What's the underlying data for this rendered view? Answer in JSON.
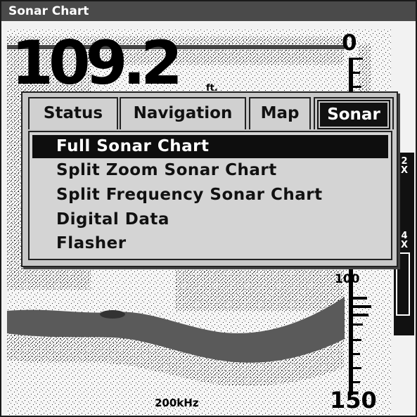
{
  "window": {
    "title": "Sonar Chart"
  },
  "readout": {
    "depth": "109.2",
    "unit": "ft."
  },
  "scale": {
    "top": "0",
    "mid": "100",
    "bottom": "150"
  },
  "frequency": "200kHz",
  "zoom": {
    "label_2x": "2\nX",
    "label_4x": "4\nX"
  },
  "menu": {
    "tabs": [
      {
        "label": "Status"
      },
      {
        "label": "Navigation"
      },
      {
        "label": "Map"
      },
      {
        "label": "Sonar",
        "selected": true
      }
    ],
    "items": [
      {
        "label": "Full Sonar Chart",
        "selected": true
      },
      {
        "label": "Split Zoom Sonar Chart"
      },
      {
        "label": "Split Frequency Sonar Chart"
      },
      {
        "label": "Digital Data"
      },
      {
        "label": "Flasher"
      }
    ]
  },
  "colors": {
    "background": "#f2f2f2",
    "title_bar": "#4a4a4a",
    "selection": "#0e0e0e",
    "menu": "#c8c8c8"
  }
}
